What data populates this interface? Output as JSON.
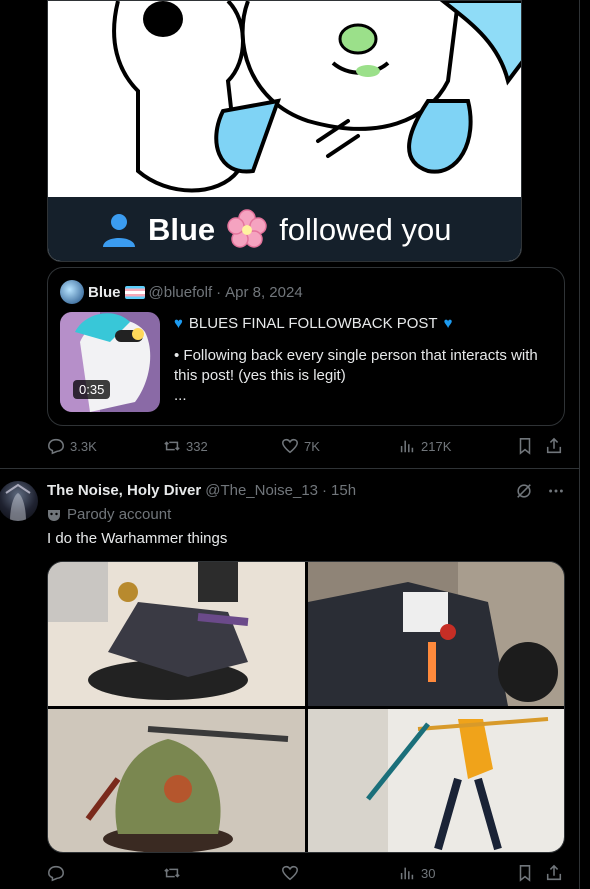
{
  "follow_card": {
    "name": "Blue",
    "action": "followed you"
  },
  "quote": {
    "author": "Blue",
    "handle": "@bluefolf",
    "date": "Apr 8, 2024",
    "duration": "0:35",
    "title": "BLUES FINAL FOLLOWBACK POST",
    "body": "• Following back every single person that interacts with this post! (yes this is legit)",
    "ellipsis": "..."
  },
  "post1_actions": {
    "replies": "3.3K",
    "reposts": "332",
    "likes": "7K",
    "views": "217K"
  },
  "post2": {
    "author": "The Noise, Holy Diver",
    "handle": "@The_Noise_13",
    "time": "15h",
    "label": "Parody account",
    "text": "I do the Warhammer things"
  },
  "post2_actions": {
    "replies": "",
    "reposts": "",
    "likes": "",
    "views": "30"
  },
  "colors": {
    "accent": "#1d9bf0",
    "muted": "#71767b",
    "border": "#2f3336"
  },
  "icons": [
    "person-icon",
    "cherry-blossom-icon",
    "reply-icon",
    "repost-icon",
    "like-icon",
    "views-icon",
    "bookmark-icon",
    "share-icon",
    "more-icon",
    "grok-icon",
    "parody-mask-icon"
  ]
}
